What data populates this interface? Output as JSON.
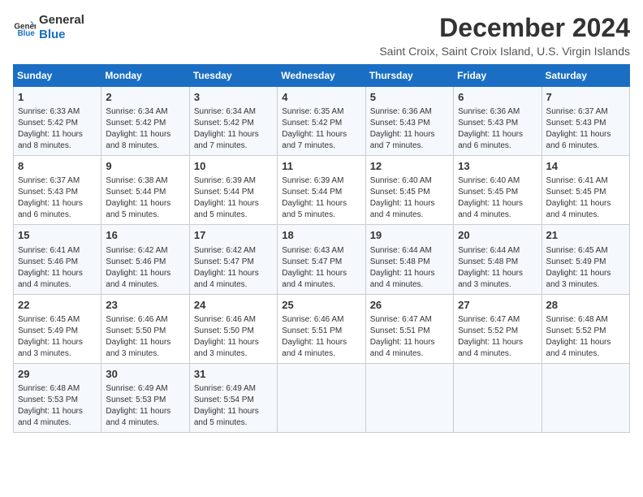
{
  "logo": {
    "line1": "General",
    "line2": "Blue"
  },
  "title": "December 2024",
  "subtitle": "Saint Croix, Saint Croix Island, U.S. Virgin Islands",
  "weekdays": [
    "Sunday",
    "Monday",
    "Tuesday",
    "Wednesday",
    "Thursday",
    "Friday",
    "Saturday"
  ],
  "weeks": [
    [
      {
        "day": "1",
        "info": "Sunrise: 6:33 AM\nSunset: 5:42 PM\nDaylight: 11 hours\nand 8 minutes."
      },
      {
        "day": "2",
        "info": "Sunrise: 6:34 AM\nSunset: 5:42 PM\nDaylight: 11 hours\nand 8 minutes."
      },
      {
        "day": "3",
        "info": "Sunrise: 6:34 AM\nSunset: 5:42 PM\nDaylight: 11 hours\nand 7 minutes."
      },
      {
        "day": "4",
        "info": "Sunrise: 6:35 AM\nSunset: 5:42 PM\nDaylight: 11 hours\nand 7 minutes."
      },
      {
        "day": "5",
        "info": "Sunrise: 6:36 AM\nSunset: 5:43 PM\nDaylight: 11 hours\nand 7 minutes."
      },
      {
        "day": "6",
        "info": "Sunrise: 6:36 AM\nSunset: 5:43 PM\nDaylight: 11 hours\nand 6 minutes."
      },
      {
        "day": "7",
        "info": "Sunrise: 6:37 AM\nSunset: 5:43 PM\nDaylight: 11 hours\nand 6 minutes."
      }
    ],
    [
      {
        "day": "8",
        "info": "Sunrise: 6:37 AM\nSunset: 5:43 PM\nDaylight: 11 hours\nand 6 minutes."
      },
      {
        "day": "9",
        "info": "Sunrise: 6:38 AM\nSunset: 5:44 PM\nDaylight: 11 hours\nand 5 minutes."
      },
      {
        "day": "10",
        "info": "Sunrise: 6:39 AM\nSunset: 5:44 PM\nDaylight: 11 hours\nand 5 minutes."
      },
      {
        "day": "11",
        "info": "Sunrise: 6:39 AM\nSunset: 5:44 PM\nDaylight: 11 hours\nand 5 minutes."
      },
      {
        "day": "12",
        "info": "Sunrise: 6:40 AM\nSunset: 5:45 PM\nDaylight: 11 hours\nand 4 minutes."
      },
      {
        "day": "13",
        "info": "Sunrise: 6:40 AM\nSunset: 5:45 PM\nDaylight: 11 hours\nand 4 minutes."
      },
      {
        "day": "14",
        "info": "Sunrise: 6:41 AM\nSunset: 5:45 PM\nDaylight: 11 hours\nand 4 minutes."
      }
    ],
    [
      {
        "day": "15",
        "info": "Sunrise: 6:41 AM\nSunset: 5:46 PM\nDaylight: 11 hours\nand 4 minutes."
      },
      {
        "day": "16",
        "info": "Sunrise: 6:42 AM\nSunset: 5:46 PM\nDaylight: 11 hours\nand 4 minutes."
      },
      {
        "day": "17",
        "info": "Sunrise: 6:42 AM\nSunset: 5:47 PM\nDaylight: 11 hours\nand 4 minutes."
      },
      {
        "day": "18",
        "info": "Sunrise: 6:43 AM\nSunset: 5:47 PM\nDaylight: 11 hours\nand 4 minutes."
      },
      {
        "day": "19",
        "info": "Sunrise: 6:44 AM\nSunset: 5:48 PM\nDaylight: 11 hours\nand 4 minutes."
      },
      {
        "day": "20",
        "info": "Sunrise: 6:44 AM\nSunset: 5:48 PM\nDaylight: 11 hours\nand 3 minutes."
      },
      {
        "day": "21",
        "info": "Sunrise: 6:45 AM\nSunset: 5:49 PM\nDaylight: 11 hours\nand 3 minutes."
      }
    ],
    [
      {
        "day": "22",
        "info": "Sunrise: 6:45 AM\nSunset: 5:49 PM\nDaylight: 11 hours\nand 3 minutes."
      },
      {
        "day": "23",
        "info": "Sunrise: 6:46 AM\nSunset: 5:50 PM\nDaylight: 11 hours\nand 3 minutes."
      },
      {
        "day": "24",
        "info": "Sunrise: 6:46 AM\nSunset: 5:50 PM\nDaylight: 11 hours\nand 3 minutes."
      },
      {
        "day": "25",
        "info": "Sunrise: 6:46 AM\nSunset: 5:51 PM\nDaylight: 11 hours\nand 4 minutes."
      },
      {
        "day": "26",
        "info": "Sunrise: 6:47 AM\nSunset: 5:51 PM\nDaylight: 11 hours\nand 4 minutes."
      },
      {
        "day": "27",
        "info": "Sunrise: 6:47 AM\nSunset: 5:52 PM\nDaylight: 11 hours\nand 4 minutes."
      },
      {
        "day": "28",
        "info": "Sunrise: 6:48 AM\nSunset: 5:52 PM\nDaylight: 11 hours\nand 4 minutes."
      }
    ],
    [
      {
        "day": "29",
        "info": "Sunrise: 6:48 AM\nSunset: 5:53 PM\nDaylight: 11 hours\nand 4 minutes."
      },
      {
        "day": "30",
        "info": "Sunrise: 6:49 AM\nSunset: 5:53 PM\nDaylight: 11 hours\nand 4 minutes."
      },
      {
        "day": "31",
        "info": "Sunrise: 6:49 AM\nSunset: 5:54 PM\nDaylight: 11 hours\nand 5 minutes."
      },
      null,
      null,
      null,
      null
    ]
  ]
}
